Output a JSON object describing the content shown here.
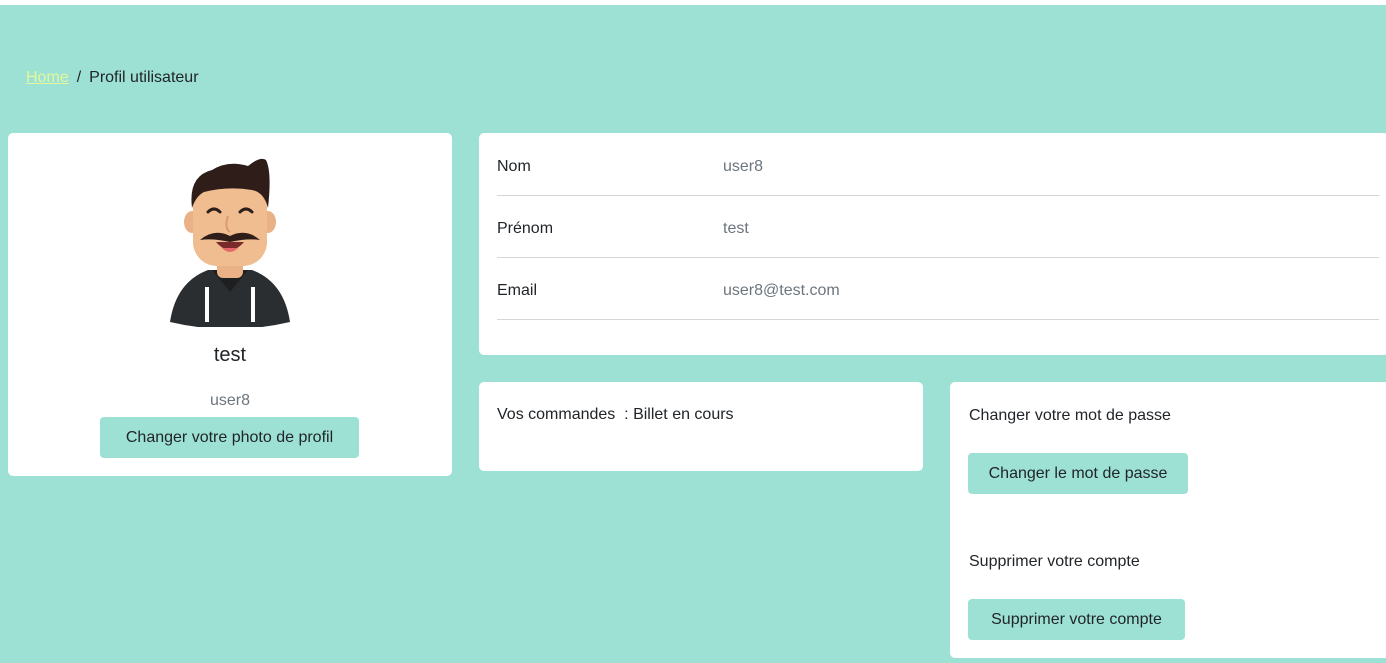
{
  "breadcrumb": {
    "home": "Home",
    "separator": "/",
    "current": "Profil utilisateur"
  },
  "profile": {
    "name": "test",
    "username": "user8",
    "change_photo_label": "Changer votre photo de profil"
  },
  "info": {
    "rows": [
      {
        "label": "Nom",
        "value": "user8"
      },
      {
        "label": "Prénom",
        "value": "test"
      },
      {
        "label": "Email",
        "value": "user8@test.com"
      }
    ]
  },
  "orders": {
    "text": "Vos commandes  : Billet en cours"
  },
  "account": {
    "password_heading": "Changer votre mot de passe",
    "password_button": "Changer le mot de passe",
    "delete_heading": "Supprimer votre compte",
    "delete_button": "Supprimer votre compte"
  },
  "colors": {
    "background": "#9de1d5",
    "accent": "#9de1d5",
    "link": "#e3f79c",
    "card": "#ffffff"
  },
  "icons": {
    "avatar": "avatar-man-mustache-hoodie"
  }
}
